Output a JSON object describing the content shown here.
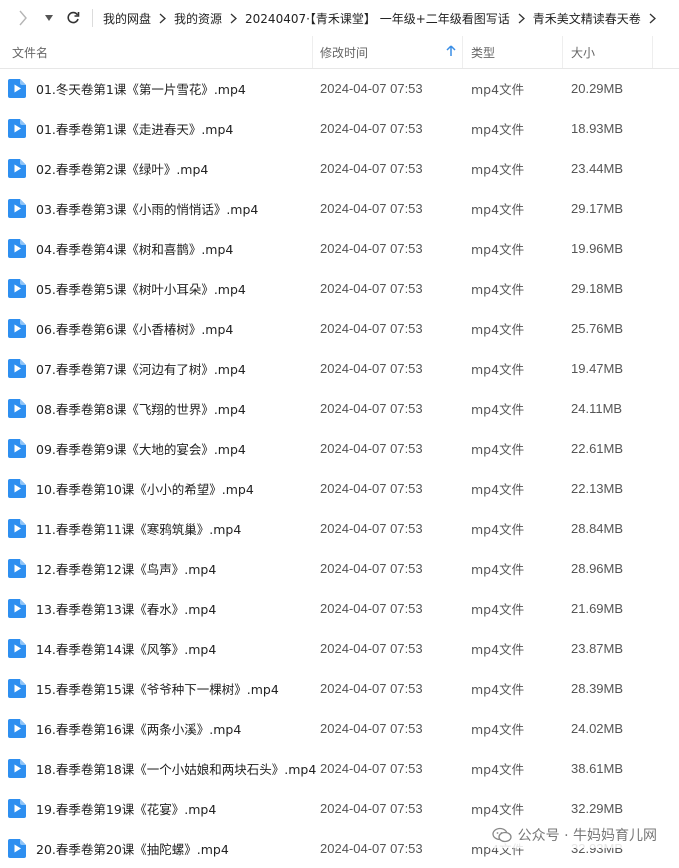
{
  "breadcrumb": [
    "我的网盘",
    "我的资源",
    "20240407·【青禾课堂】 一年级+二年级看图写话",
    "青禾美文精读春天卷"
  ],
  "columns": {
    "name": "文件名",
    "modified": "修改时间",
    "type": "类型",
    "size": "大小"
  },
  "files": [
    {
      "name": "01.冬天卷第1课《第一片雪花》.mp4",
      "modified": "2024-04-07 07:53",
      "type": "mp4文件",
      "size": "20.29MB"
    },
    {
      "name": "01.春季卷第1课《走进春天》.mp4",
      "modified": "2024-04-07 07:53",
      "type": "mp4文件",
      "size": "18.93MB"
    },
    {
      "name": "02.春季卷第2课《绿叶》.mp4",
      "modified": "2024-04-07 07:53",
      "type": "mp4文件",
      "size": "23.44MB"
    },
    {
      "name": "03.春季卷第3课《小雨的悄悄话》.mp4",
      "modified": "2024-04-07 07:53",
      "type": "mp4文件",
      "size": "29.17MB"
    },
    {
      "name": "04.春季卷第4课《树和喜鹊》.mp4",
      "modified": "2024-04-07 07:53",
      "type": "mp4文件",
      "size": "19.96MB"
    },
    {
      "name": "05.春季卷第5课《树叶小耳朵》.mp4",
      "modified": "2024-04-07 07:53",
      "type": "mp4文件",
      "size": "29.18MB"
    },
    {
      "name": "06.春季卷第6课《小香椿树》.mp4",
      "modified": "2024-04-07 07:53",
      "type": "mp4文件",
      "size": "25.76MB"
    },
    {
      "name": "07.春季卷第7课《河边有了树》.mp4",
      "modified": "2024-04-07 07:53",
      "type": "mp4文件",
      "size": "19.47MB"
    },
    {
      "name": "08.春季卷第8课《飞翔的世界》.mp4",
      "modified": "2024-04-07 07:53",
      "type": "mp4文件",
      "size": "24.11MB"
    },
    {
      "name": "09.春季卷第9课《大地的宴会》.mp4",
      "modified": "2024-04-07 07:53",
      "type": "mp4文件",
      "size": "22.61MB"
    },
    {
      "name": "10.春季卷第10课《小小的希望》.mp4",
      "modified": "2024-04-07 07:53",
      "type": "mp4文件",
      "size": "22.13MB"
    },
    {
      "name": "11.春季卷第11课《寒鸦筑巢》.mp4",
      "modified": "2024-04-07 07:53",
      "type": "mp4文件",
      "size": "28.84MB"
    },
    {
      "name": "12.春季卷第12课《鸟声》.mp4",
      "modified": "2024-04-07 07:53",
      "type": "mp4文件",
      "size": "28.96MB"
    },
    {
      "name": "13.春季卷第13课《春水》.mp4",
      "modified": "2024-04-07 07:53",
      "type": "mp4文件",
      "size": "21.69MB"
    },
    {
      "name": "14.春季卷第14课《风筝》.mp4",
      "modified": "2024-04-07 07:53",
      "type": "mp4文件",
      "size": "23.87MB"
    },
    {
      "name": "15.春季卷第15课《爷爷种下一棵树》.mp4",
      "modified": "2024-04-07 07:53",
      "type": "mp4文件",
      "size": "28.39MB"
    },
    {
      "name": "16.春季卷第16课《两条小溪》.mp4",
      "modified": "2024-04-07 07:53",
      "type": "mp4文件",
      "size": "24.02MB"
    },
    {
      "name": "18.春季卷第18课《一个小姑娘和两块石头》.mp4",
      "modified": "2024-04-07 07:53",
      "type": "mp4文件",
      "size": "38.61MB"
    },
    {
      "name": "19.春季卷第19课《花宴》.mp4",
      "modified": "2024-04-07 07:53",
      "type": "mp4文件",
      "size": "32.29MB"
    },
    {
      "name": "20.春季卷第20课《抽陀螺》.mp4",
      "modified": "2024-04-07 07:53",
      "type": "mp4文件",
      "size": "32.93MB"
    }
  ],
  "watermark": "公众号 · 牛妈妈育儿网",
  "colors": {
    "video_icon": "#2e8ff0",
    "sort_arrow": "#3a8ee6",
    "text": "#222222",
    "muted": "#555555"
  },
  "icons": {
    "file": "video-file-icon",
    "sort": "sort-ascending-icon"
  }
}
